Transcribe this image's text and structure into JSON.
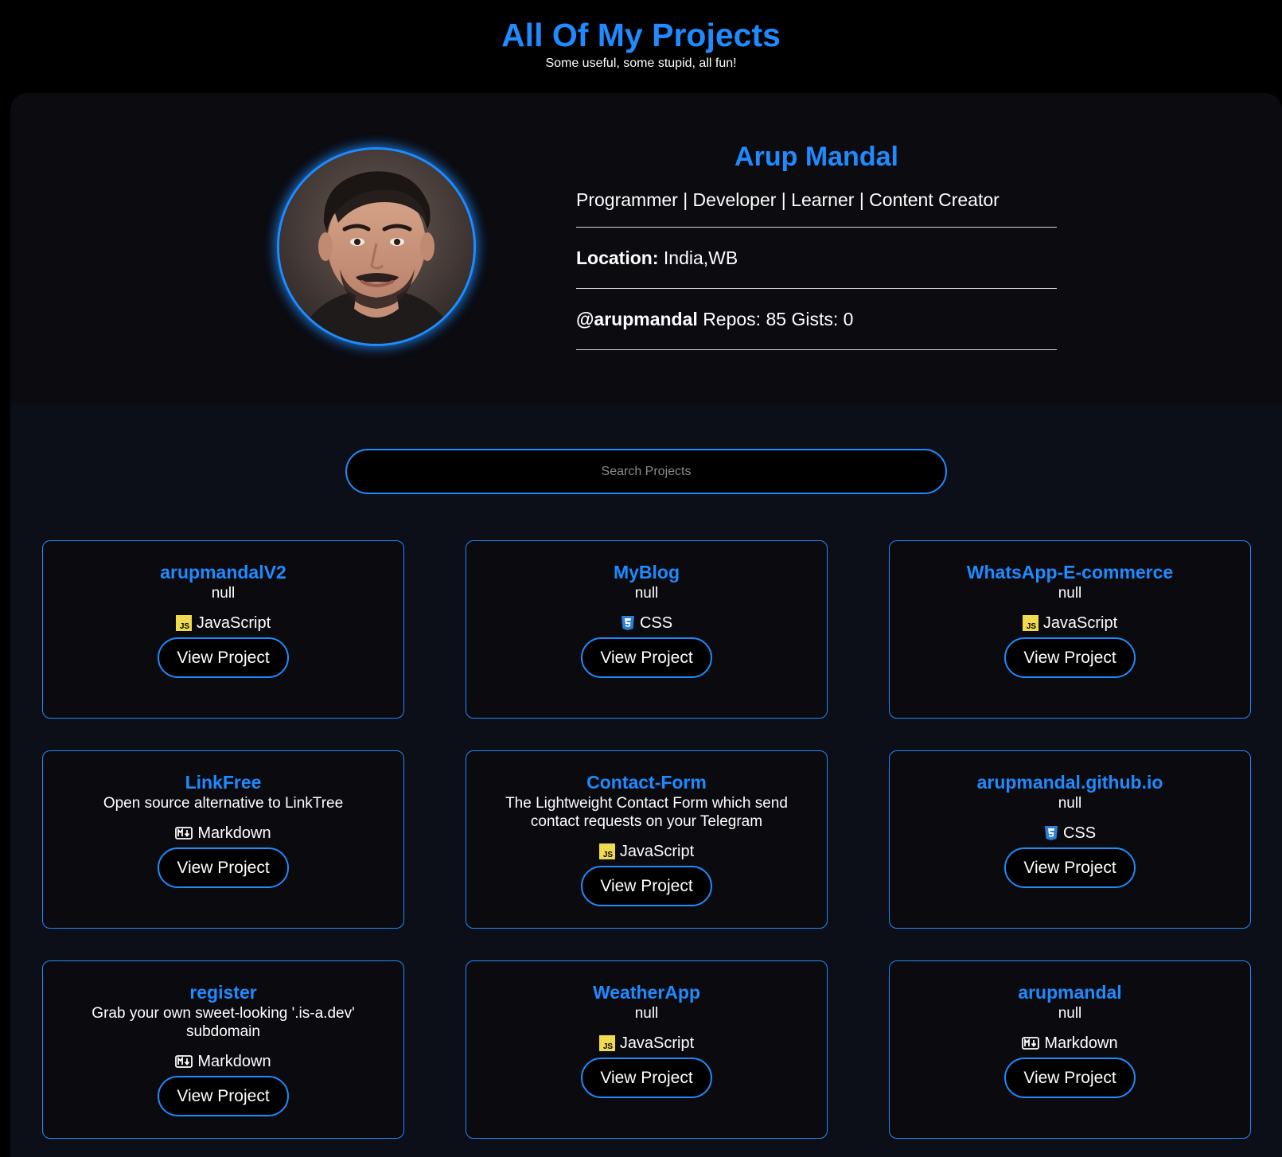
{
  "header": {
    "title": "All Of My Projects",
    "subtitle": "Some useful, some stupid, all fun!"
  },
  "profile": {
    "name": "Arup Mandal",
    "tagline": "Programmer | Developer | Learner | Content Creator",
    "location_label": "Location:",
    "location_value": "India,WB",
    "handle": "@arupmandal",
    "repos_label": "Repos:",
    "repos": "85",
    "gists_label": "Gists:",
    "gists": "0"
  },
  "search": {
    "placeholder": "Search Projects"
  },
  "projects": [
    {
      "title": "arupmandalV2",
      "description": "null",
      "language": "JavaScript",
      "lang_icon": "javascript-icon",
      "button": "View Project"
    },
    {
      "title": "MyBlog",
      "description": "null",
      "language": "CSS",
      "lang_icon": "css-icon",
      "button": "View Project"
    },
    {
      "title": "WhatsApp-E-commerce",
      "description": "null",
      "language": "JavaScript",
      "lang_icon": "javascript-icon",
      "button": "View Project"
    },
    {
      "title": "LinkFree",
      "description": "Open source alternative to LinkTree",
      "language": "Markdown",
      "lang_icon": "markdown-icon",
      "button": "View Project"
    },
    {
      "title": "Contact-Form",
      "description": "The Lightweight Contact Form which send contact requests on your Telegram",
      "language": "JavaScript",
      "lang_icon": "javascript-icon",
      "button": "View Project"
    },
    {
      "title": "arupmandal.github.io",
      "description": "null",
      "language": "CSS",
      "lang_icon": "css-icon",
      "button": "View Project"
    },
    {
      "title": "register",
      "description": "Grab your own sweet-looking '.is-a.dev' subdomain",
      "language": "Markdown",
      "lang_icon": "markdown-icon",
      "button": "View Project"
    },
    {
      "title": "WeatherApp",
      "description": "null",
      "language": "JavaScript",
      "lang_icon": "javascript-icon",
      "button": "View Project"
    },
    {
      "title": "arupmandal",
      "description": "null",
      "language": "Markdown",
      "lang_icon": "markdown-icon",
      "button": "View Project"
    }
  ],
  "colors": {
    "accent": "#1f8bff",
    "background": "#000000",
    "panel": "#0c0e18",
    "card": "#0a0a0f",
    "js_badge": "#f0db4f",
    "css_badge": "#2b7fd9"
  }
}
